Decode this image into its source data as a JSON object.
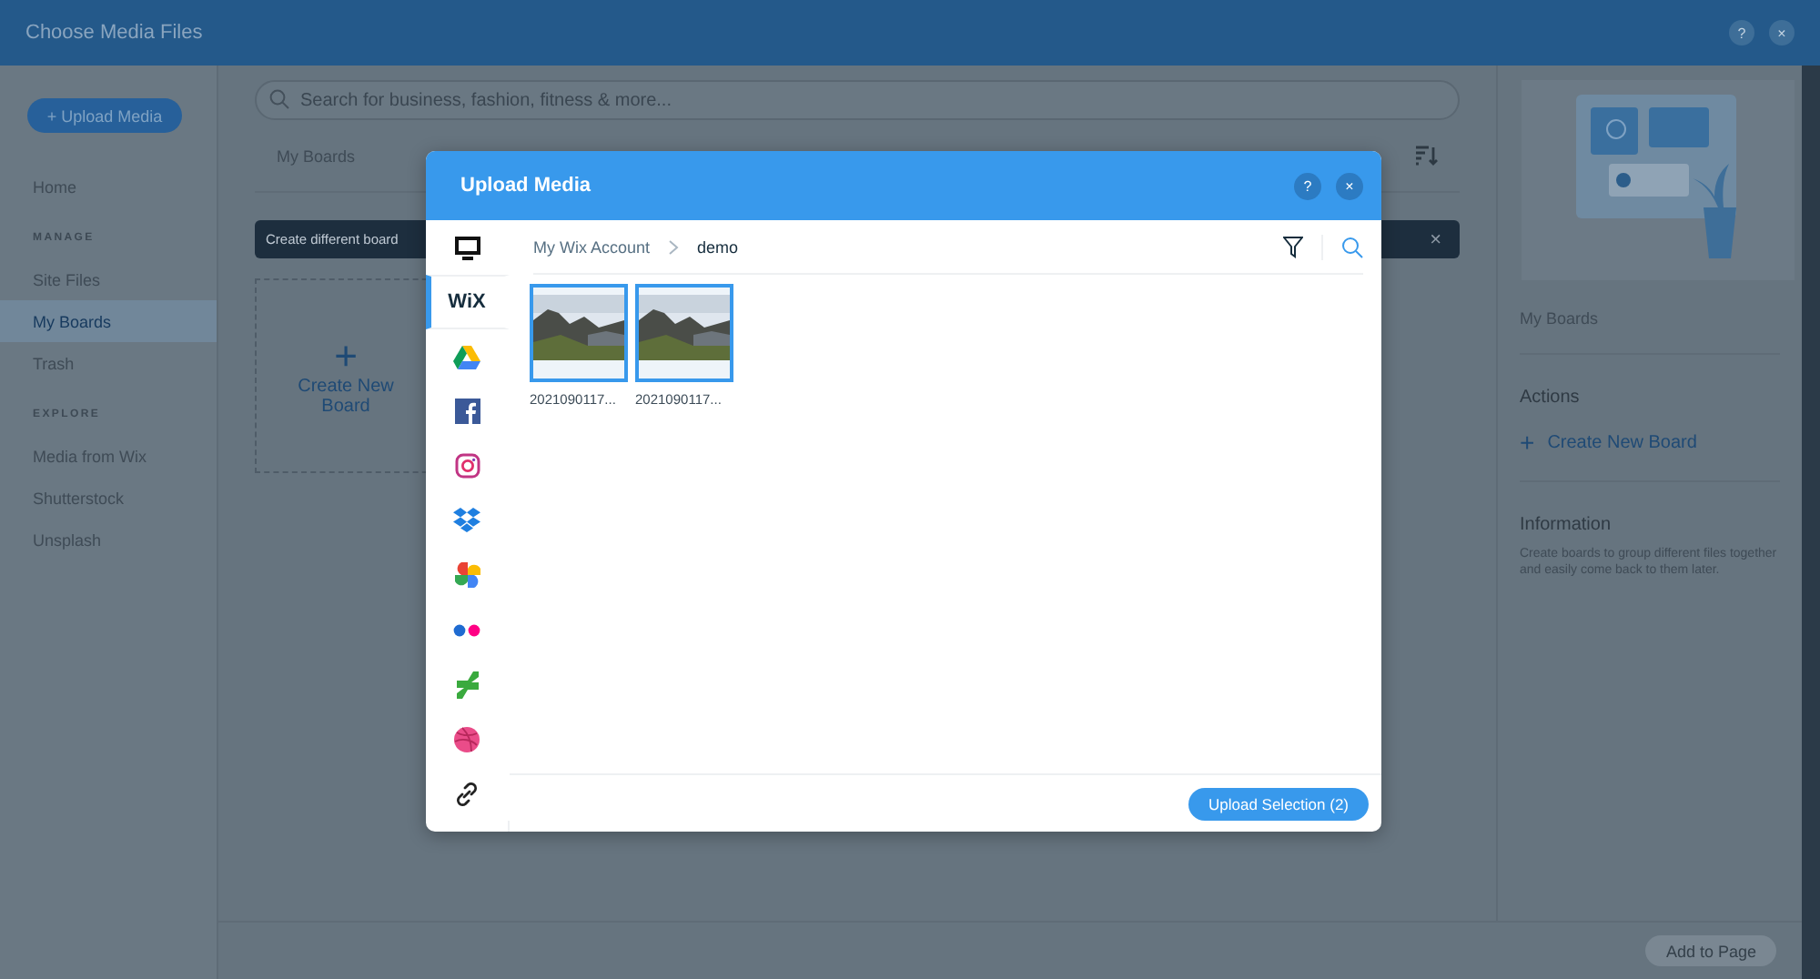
{
  "window": {
    "title": "Choose Media Files",
    "help": "?",
    "close": "×"
  },
  "sidebar": {
    "upload_button": "+ Upload Media",
    "sections": [
      {
        "items": [
          {
            "label": "Home",
            "selected": false
          }
        ]
      },
      {
        "heading": "MANAGE",
        "items": [
          {
            "label": "Site Files",
            "selected": false
          },
          {
            "label": "My Boards",
            "selected": true
          },
          {
            "label": "Trash",
            "selected": false
          }
        ]
      },
      {
        "heading": "EXPLORE",
        "items": [
          {
            "label": "Media from Wix",
            "selected": false
          },
          {
            "label": "Shutterstock",
            "selected": false
          },
          {
            "label": "Unsplash",
            "selected": false
          }
        ]
      }
    ]
  },
  "main": {
    "search": {
      "placeholder": "Search for business, fashion, fitness & more..."
    },
    "breadcrumb": "My Boards",
    "banner": {
      "text": "Create different board",
      "close": "×"
    },
    "new_board": {
      "plus": "+",
      "label": "Create New Board"
    }
  },
  "right_panel": {
    "title": "My Boards",
    "actions_heading": "Actions",
    "action": {
      "plus": "+",
      "label": "Create New Board"
    },
    "info_heading": "Information",
    "info_text": "Create boards to group different files together and easily come back to them later."
  },
  "footer": {
    "add_button": "Add to Page",
    "disabled": true
  },
  "dialog": {
    "title": "Upload Media",
    "help": "?",
    "close": "×",
    "sources": [
      {
        "kind": "computer",
        "selected": false
      },
      {
        "kind": "wix",
        "label": "WiX",
        "selected": true
      },
      {
        "kind": "drive",
        "selected": false
      },
      {
        "kind": "facebook",
        "selected": false
      },
      {
        "kind": "instagram",
        "selected": false
      },
      {
        "kind": "dropbox",
        "selected": false
      },
      {
        "kind": "photos",
        "selected": false
      },
      {
        "kind": "flickr",
        "selected": false
      },
      {
        "kind": "deviantart",
        "selected": false
      },
      {
        "kind": "dribbble",
        "selected": false
      },
      {
        "kind": "link",
        "selected": false
      }
    ],
    "path": [
      {
        "label": "My Wix Account"
      },
      {
        "label": "demo"
      }
    ],
    "files": [
      {
        "name": "2021090117...",
        "selected": true,
        "kind": "picture"
      },
      {
        "name": "2021090117...",
        "selected": true,
        "kind": "picture"
      }
    ],
    "upload_button": "Upload Selection (2)"
  }
}
